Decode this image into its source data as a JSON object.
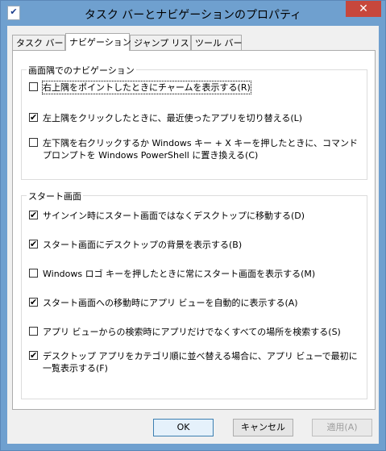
{
  "window": {
    "title": "タスク バーとナビゲーションのプロパティ",
    "close_glyph": "✕",
    "app_icon": "✔"
  },
  "tabs": [
    {
      "label": "タスク バー"
    },
    {
      "label": "ナビゲーション"
    },
    {
      "label": "ジャンプ リスト"
    },
    {
      "label": "ツール バー"
    }
  ],
  "navigation_group": {
    "title": "画面隅でのナビゲーション",
    "options": [
      {
        "label": "右上隅をポイントしたときにチャームを表示する(R)",
        "checked": false
      },
      {
        "label": "左上隅をクリックしたときに、最近使ったアプリを切り替える(L)",
        "checked": true
      },
      {
        "label": "左下隅を右クリックするか Windows キー + X キーを押したときに、コマンド プロンプトを Windows PowerShell に置き換える(C)",
        "checked": false
      }
    ]
  },
  "start_group": {
    "title": "スタート画面",
    "options": [
      {
        "label": "サインイン時にスタート画面ではなくデスクトップに移動する(D)",
        "checked": true
      },
      {
        "label": "スタート画面にデスクトップの背景を表示する(B)",
        "checked": true
      },
      {
        "label": "Windows ロゴ キーを押したときに常にスタート画面を表示する(M)",
        "checked": false
      },
      {
        "label": "スタート画面への移動時にアプリ ビューを自動的に表示する(A)",
        "checked": true
      },
      {
        "label": "アプリ ビューからの検索時にアプリだけでなくすべての場所を検索する(S)",
        "checked": false
      },
      {
        "label": "デスクトップ アプリをカテゴリ順に並べ替える場合に、アプリ ビューで最初に一覧表示する(F)",
        "checked": true
      }
    ]
  },
  "buttons": {
    "ok": "OK",
    "cancel": "キャンセル",
    "apply": "適用(A)"
  },
  "check_glyph": "✔"
}
